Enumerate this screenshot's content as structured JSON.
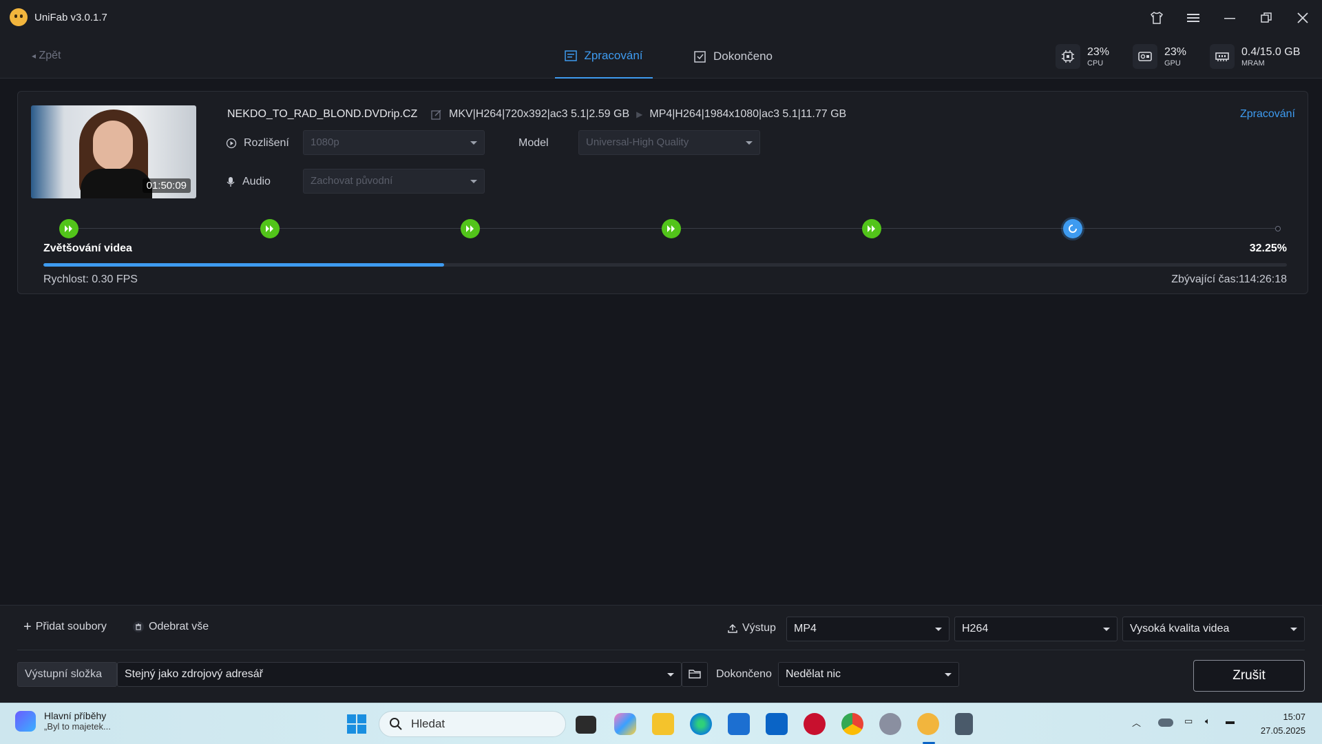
{
  "app": {
    "title": "UniFab v3.0.1.7"
  },
  "header": {
    "back_label": "Zpět",
    "tabs": [
      {
        "label": "Zpracování",
        "active": true
      },
      {
        "label": "Dokončeno",
        "active": false
      }
    ],
    "stats": [
      {
        "value": "23%",
        "label": "CPU",
        "icon": "cpu-icon"
      },
      {
        "value": "23%",
        "label": "GPU",
        "icon": "gpu-icon"
      },
      {
        "value": "0.4/15.0 GB",
        "label": "MRAM",
        "icon": "memory-icon"
      }
    ]
  },
  "task": {
    "filename": "NEKDO_TO_RAD_BLOND.DVDrip.CZ",
    "duration": "01:50:09",
    "source_format": "MKV|H264|720x392|ac3 5.1|2.59 GB",
    "target_format": "MP4|H264|1984x1080|ac3 5.1|11.77 GB",
    "status": "Zpracování",
    "resolution_label": "Rozlišení",
    "resolution_value": "1080p",
    "model_label": "Model",
    "model_value": "Universal-High Quality",
    "audio_label": "Audio",
    "audio_value": "Zachovat původní",
    "steps_done": 5,
    "steps_total": 7,
    "stage": "Zvětšování videa",
    "percent_text": "32.25%",
    "progress": 0.3225,
    "speed": "Rychlost: 0.30  FPS",
    "remaining": "Zbývající čas:114:26:18"
  },
  "bottom": {
    "add_files": "Přidat soubory",
    "remove_all": "Odebrat vše",
    "output_label": "Výstup",
    "output_format": "MP4",
    "output_codec": "H264",
    "output_quality": "Vysoká kvalita videa",
    "folder_label": "Výstupní složka",
    "folder_value": "Stejný jako zdrojový adresář",
    "done_label": "Dokončeno",
    "done_action": "Nedělat nic",
    "cancel": "Zrušit"
  },
  "taskbar": {
    "news_title": "Hlavní příběhy",
    "news_sub": "„Byl to majetek...",
    "search_placeholder": "Hledat",
    "time": "15:07",
    "date": "27.05.2025"
  },
  "colors": {
    "accent": "#3e9bf0",
    "done": "#52c41a",
    "bg": "#15171d"
  }
}
